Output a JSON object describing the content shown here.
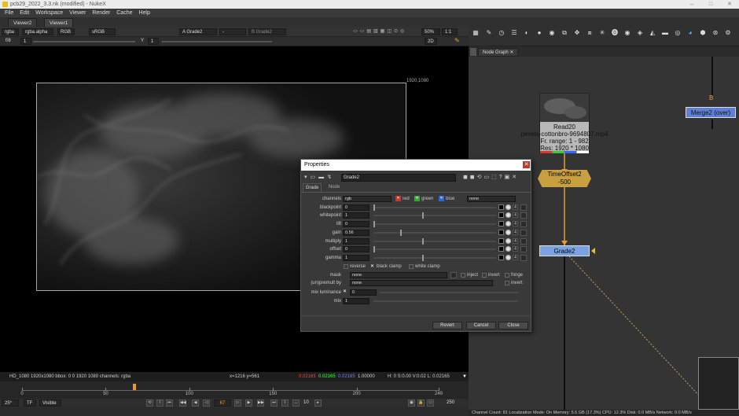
{
  "window": {
    "title": "pcb29_2022_3.3.nk (modified) - NukeX",
    "min": "–",
    "max": "□",
    "close": "✕"
  },
  "menu": [
    "File",
    "Edit",
    "Workspace",
    "Viewer",
    "Render",
    "Cache",
    "Help"
  ],
  "viewer_tabs": [
    "Viewer2",
    "Viewer1"
  ],
  "viewer_toolbar": {
    "channels": "rgba",
    "alpha": "rgba.alpha",
    "colorspace": "RGB",
    "lut": "sRGB",
    "input_a": "A  Grade2",
    "input_sep": "-",
    "input_b": "B  Grade2",
    "zoom": "50%",
    "ratio": "1:1",
    "mode": "2D"
  },
  "viewer_toolbar2": {
    "f_stop_label": "f/8",
    "frame": "1",
    "y_label": "Y",
    "gain": "1"
  },
  "viewer": {
    "resolution_label": "1920,1080"
  },
  "info_bar": {
    "format": "HD_1080 1920x1080  bbox: 0 0 1920 1080 channels: rgba",
    "coords": "x=1216 y=561",
    "r": "0.02165",
    "g": "0.02165",
    "b": "0.02165",
    "a": "1.00000",
    "hsv": "H: 0 S:0.00 V:0.02  L: 0.02165",
    "colors": {
      "r": "#ff4040",
      "g": "#40ff40",
      "b": "#6060ff"
    }
  },
  "timeline": {
    "ticks": [
      "0",
      "50",
      "100",
      "150",
      "200",
      "249"
    ],
    "tick_values": [
      0,
      50,
      100,
      150,
      200,
      249
    ],
    "start": 0,
    "end": 249,
    "current": 67,
    "fps": "25*",
    "tf": "TF",
    "visible": "Visible",
    "current_frame": "67",
    "step": "10",
    "end_frame": "250"
  },
  "node_graph_tab": "Node Graph",
  "nodes": {
    "read": {
      "name": "Read20",
      "file": "pexels-cottonbro-9694807.mp4",
      "range": "Fr. range: 1 - 982",
      "res": "Res: 1920 * 1080"
    },
    "timeoffset": {
      "name": "TimeOffset2",
      "value": "-500"
    },
    "grade": {
      "name": "Grade2"
    },
    "merge": {
      "name": "Merge2 (over)",
      "b_input": "B"
    }
  },
  "status_bar": "Channel Count: 81  Localization Mode: On  Memory: 5.5 GB (17.3%)  CPU: 12.3%  Disk: 0.0 MB/s  Network: 0.0 MB/s",
  "properties": {
    "title": "Properties",
    "node_name": "Grade2",
    "tabs": [
      "Grade",
      "Node"
    ],
    "channels": {
      "label": "channels",
      "value": "rgb",
      "red": "red",
      "green": "green",
      "blue": "blue",
      "extra": "none"
    },
    "knobs": [
      {
        "label": "blackpoint",
        "value": "0",
        "level": 0.0
      },
      {
        "label": "whitepoint",
        "value": "1",
        "level": 0.4
      },
      {
        "label": "lift",
        "value": "0",
        "level": 0.0
      },
      {
        "label": "gain",
        "value": "0.56",
        "level": 0.22
      },
      {
        "label": "multiply",
        "value": "1",
        "level": 0.4
      },
      {
        "label": "offset",
        "value": "0",
        "level": 0.0
      },
      {
        "label": "gamma",
        "value": "1",
        "level": 0.4
      }
    ],
    "options": {
      "reverse": "reverse",
      "black_clamp": "black clamp",
      "white_clamp": "white clamp"
    },
    "mask": {
      "label": "mask",
      "value": "none",
      "inject": "inject",
      "invert": "invert",
      "fringe": "fringe"
    },
    "premult": {
      "label": "(un)premult by",
      "value": "none",
      "invert": "invert"
    },
    "mix_luminance": {
      "label": "mix luminance",
      "value": "0"
    },
    "mix": {
      "label": "mix",
      "value": "1"
    },
    "slider_ticks": [
      "0",
      "0.1",
      "0.2",
      "0.3",
      "0.4",
      "0.5",
      "0.6",
      "0.7",
      "0.8",
      "0.9",
      "1"
    ],
    "buttons": {
      "revert": "Revert",
      "cancel": "Cancel",
      "close": "Close"
    }
  }
}
